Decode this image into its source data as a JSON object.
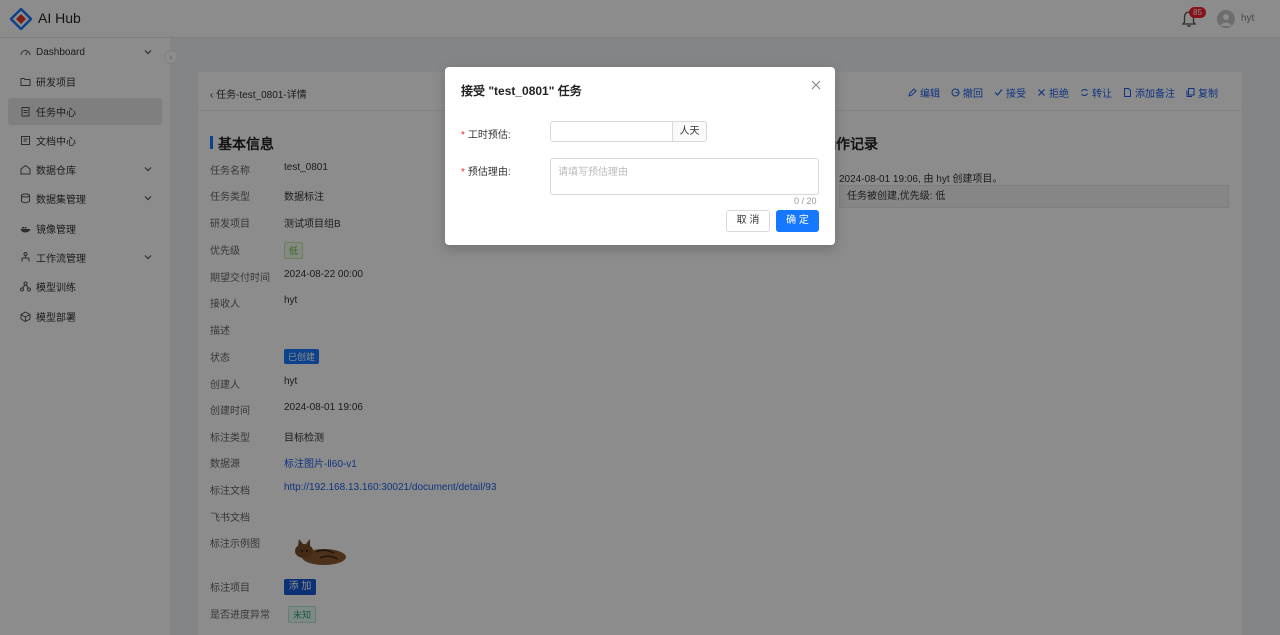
{
  "header": {
    "app_name": "AI Hub",
    "notification_count": "85",
    "username": "hyt"
  },
  "sidebar": {
    "items": [
      {
        "label": "Dashboard",
        "icon": "dashboard-icon",
        "expandable": true
      },
      {
        "label": "研发项目",
        "icon": "folder-icon",
        "expandable": false
      },
      {
        "label": "任务中心",
        "icon": "task-icon",
        "expandable": false,
        "active": true
      },
      {
        "label": "文档中心",
        "icon": "document-icon",
        "expandable": false
      },
      {
        "label": "数据仓库",
        "icon": "warehouse-icon",
        "expandable": true
      },
      {
        "label": "数据集管理",
        "icon": "dataset-icon",
        "expandable": true
      },
      {
        "label": "镜像管理",
        "icon": "docker-icon",
        "expandable": false
      },
      {
        "label": "工作流管理",
        "icon": "workflow-icon",
        "expandable": true
      },
      {
        "label": "模型训练",
        "icon": "training-icon",
        "expandable": false
      },
      {
        "label": "模型部署",
        "icon": "deploy-icon",
        "expandable": false
      }
    ]
  },
  "page": {
    "back_title": "任务-test_0801-详情",
    "actions": [
      {
        "label": "编辑",
        "icon": "edit-icon"
      },
      {
        "label": "撤回",
        "icon": "undo-icon"
      },
      {
        "label": "接受",
        "icon": "check-icon"
      },
      {
        "label": "拒绝",
        "icon": "close-icon"
      },
      {
        "label": "转让",
        "icon": "transfer-icon"
      },
      {
        "label": "添加备注",
        "icon": "note-icon"
      },
      {
        "label": "复制",
        "icon": "copy-icon"
      }
    ],
    "basic_info_title": "基本信息",
    "fields": {
      "task_name": {
        "label": "任务名称",
        "value": "test_0801"
      },
      "task_type": {
        "label": "任务类型",
        "value": "数据标注"
      },
      "project": {
        "label": "研发项目",
        "value": "测试项目组B"
      },
      "priority": {
        "label": "优先级",
        "value": "低"
      },
      "due": {
        "label": "期望交付时间",
        "value": "2024-08-22 00:00"
      },
      "receiver": {
        "label": "接收人",
        "value": "hyt"
      },
      "desc": {
        "label": "描述",
        "value": ""
      },
      "status": {
        "label": "状态",
        "value": "已创建"
      },
      "creator": {
        "label": "创建人",
        "value": "hyt"
      },
      "created": {
        "label": "创建时间",
        "value": "2024-08-01 19:06"
      },
      "annot_type": {
        "label": "标注类型",
        "value": "目标检测"
      },
      "source": {
        "label": "数据源",
        "value": "标注图片-ll60-v1"
      },
      "annot_doc": {
        "label": "标注文档",
        "value": "http://192.168.13.160:30021/document/detail/93"
      },
      "feishu_doc": {
        "label": "飞书文档",
        "value": ""
      },
      "example": {
        "label": "标注示例图",
        "value": ""
      },
      "annot_items": {
        "label": "标注项目",
        "value": "添 加"
      },
      "progress_abnormal": {
        "label": "是否进度异常",
        "value": "未知"
      }
    },
    "log_title": "操作记录",
    "log_entry": "2024-08-01 19:06, 由 hyt 创建项目。",
    "log_detail": "任务被创建,优先级: 低"
  },
  "modal": {
    "title": "接受 \"test_0801\" 任务",
    "hours_label": "工时预估:",
    "hours_value": "",
    "hours_unit": "人天",
    "reason_label": "预估理由:",
    "reason_placeholder": "请填写预估理由",
    "counter": "0 / 20",
    "cancel": "取 消",
    "ok": "确 定"
  },
  "colors": {
    "primary": "#1677ff",
    "link": "#1d5ee8",
    "required": "#f5222d"
  }
}
